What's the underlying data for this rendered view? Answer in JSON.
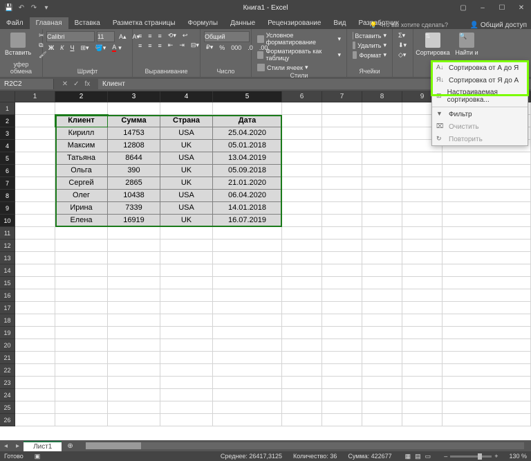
{
  "title": "Книга1 - Excel",
  "qat": {
    "save": "💾",
    "undo": "↶",
    "redo": "↷"
  },
  "winctl": {
    "min": "–",
    "max": "☐",
    "close": "✕"
  },
  "tabs": {
    "items": [
      "Файл",
      "Главная",
      "Вставка",
      "Разметка страницы",
      "Формулы",
      "Данные",
      "Рецензирование",
      "Вид",
      "Разработчик"
    ],
    "active_index": 1,
    "tell_me": "Что вы хотите сделать?",
    "share": "Общий доступ"
  },
  "ribbon": {
    "clipboard": {
      "paste": "Вставить",
      "label": "уфер обмена"
    },
    "font": {
      "name": "Calibri",
      "size": "11",
      "label": "Шрифт"
    },
    "align": {
      "label": "Выравнивание"
    },
    "number": {
      "format": "Общий",
      "label": "Число"
    },
    "styles": {
      "cond": "Условное форматирование",
      "table": "Форматировать как таблицу",
      "cells": "Стили ячеек",
      "label": "Стили"
    },
    "cells_grp": {
      "insert": "Вставить",
      "delete": "Удалить",
      "format": "Формат",
      "label": "Ячейки"
    },
    "editing": {
      "sort": "Сортировка",
      "find": "Найти и"
    }
  },
  "formula": {
    "name_box": "R2C2",
    "fx": "fx",
    "value": "Клиент"
  },
  "columns": [
    "1",
    "2",
    "3",
    "4",
    "5",
    "6",
    "7",
    "8",
    "9"
  ],
  "data": {
    "headers": [
      "Клиент",
      "Сумма",
      "Страна",
      "Дата"
    ],
    "rows": [
      [
        "Кирилл",
        "14753",
        "USA",
        "25.04.2020"
      ],
      [
        "Максим",
        "12808",
        "UK",
        "05.01.2018"
      ],
      [
        "Татьяна",
        "8644",
        "USA",
        "13.04.2019"
      ],
      [
        "Ольга",
        "390",
        "UK",
        "05.09.2018"
      ],
      [
        "Сергей",
        "2865",
        "UK",
        "21.01.2020"
      ],
      [
        "Олег",
        "10438",
        "USA",
        "06.04.2020"
      ],
      [
        "Ирина",
        "7339",
        "USA",
        "14.01.2018"
      ],
      [
        "Елена",
        "16919",
        "UK",
        "16.07.2019"
      ]
    ]
  },
  "dropdown": {
    "sort_az": "Сортировка от А до Я",
    "sort_za": "Сортировка от Я до А",
    "custom": "Настраиваемая сортировка...",
    "filter": "Фильтр",
    "clear": "Очистить",
    "reapply": "Повторить"
  },
  "sheet_tab": "Лист1",
  "status": {
    "ready": "Готово",
    "avg": "Среднее: 26417,3125",
    "count": "Количество: 36",
    "sum": "Сумма: 422677",
    "zoom": "130 %"
  }
}
